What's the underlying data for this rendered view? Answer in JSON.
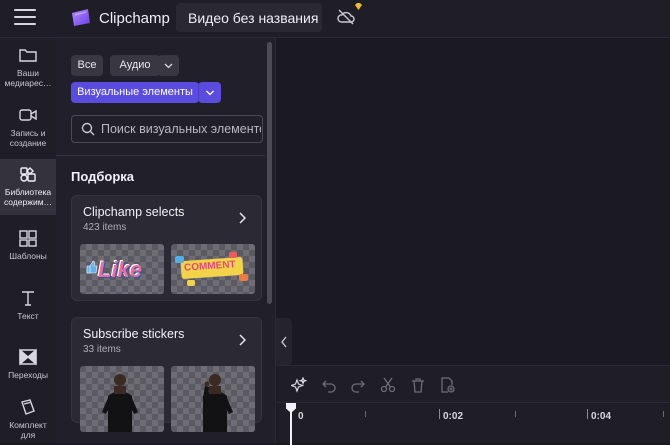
{
  "header": {
    "app_name": "Clipchamp",
    "project_title": "Видео без названия"
  },
  "leftnav": [
    {
      "label": "Ваши\nмедиарес…",
      "icon": "folder-icon"
    },
    {
      "label": "Запись и\nсоздание",
      "icon": "video-camera-icon"
    },
    {
      "label": "Библиотека\nсодержим…",
      "icon": "content-library-icon",
      "active": true
    },
    {
      "label": "Шаблоны",
      "icon": "templates-icon"
    },
    {
      "label": "Текст",
      "icon": "text-icon"
    },
    {
      "label": "Переходы",
      "icon": "transitions-icon"
    },
    {
      "label": "Комплект\nдля",
      "icon": "brand-kit-icon"
    }
  ],
  "filters": {
    "all": "Все",
    "audio": "Аудио",
    "visual": "Визуальные элементы"
  },
  "search": {
    "placeholder": "Поиск визуальных элементов"
  },
  "section_title": "Подборка",
  "cards": [
    {
      "title": "Clipchamp selects",
      "subtitle": "423 items",
      "thumbs": [
        "Like",
        "COMMENT"
      ]
    },
    {
      "title": "Subscribe stickers",
      "subtitle": "33 items",
      "thumbs": [
        "",
        ""
      ]
    }
  ],
  "timeline": {
    "labels": [
      "0",
      "0:02",
      "0:04"
    ]
  },
  "colors": {
    "accent": "#5b4ce0",
    "background": "#1b1a22",
    "panel": "#21202a"
  }
}
